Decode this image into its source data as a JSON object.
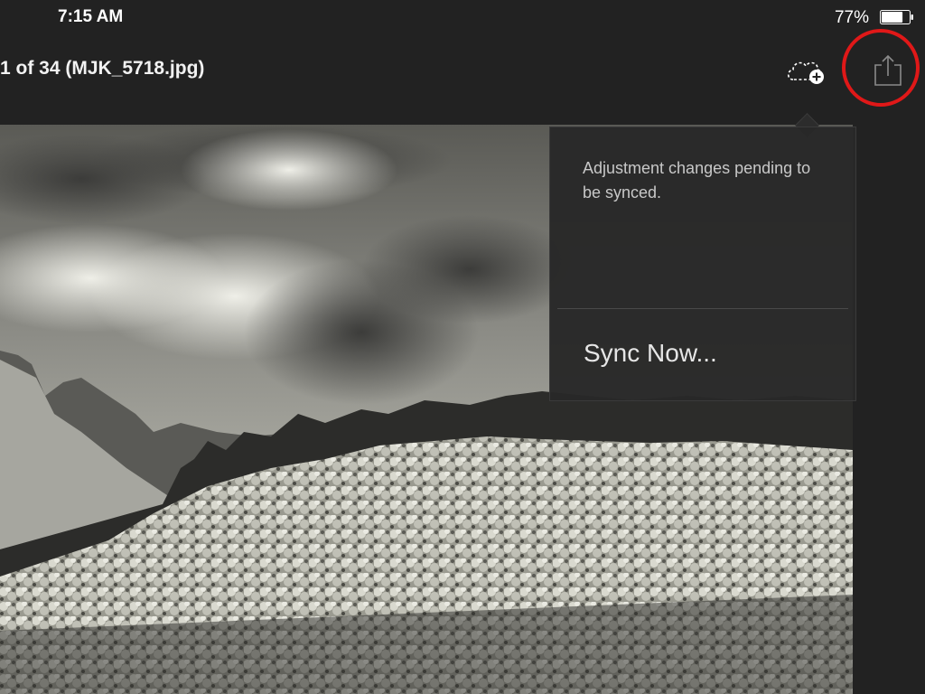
{
  "status_bar": {
    "time": "7:15 AM",
    "battery_percent": "77%",
    "battery_level": 0.77
  },
  "nav_bar": {
    "title": "1 of 34 (MJK_5718.jpg)",
    "cloud_icon": "cloud-add-icon",
    "share_icon": "share-icon"
  },
  "highlight": {
    "target": "share-button",
    "color": "#e01818"
  },
  "popover": {
    "message": "Adjustment changes pending to be synced.",
    "action_label": "Sync Now..."
  },
  "colors": {
    "background": "#222222",
    "popover_bg": "#2a2a2a"
  }
}
